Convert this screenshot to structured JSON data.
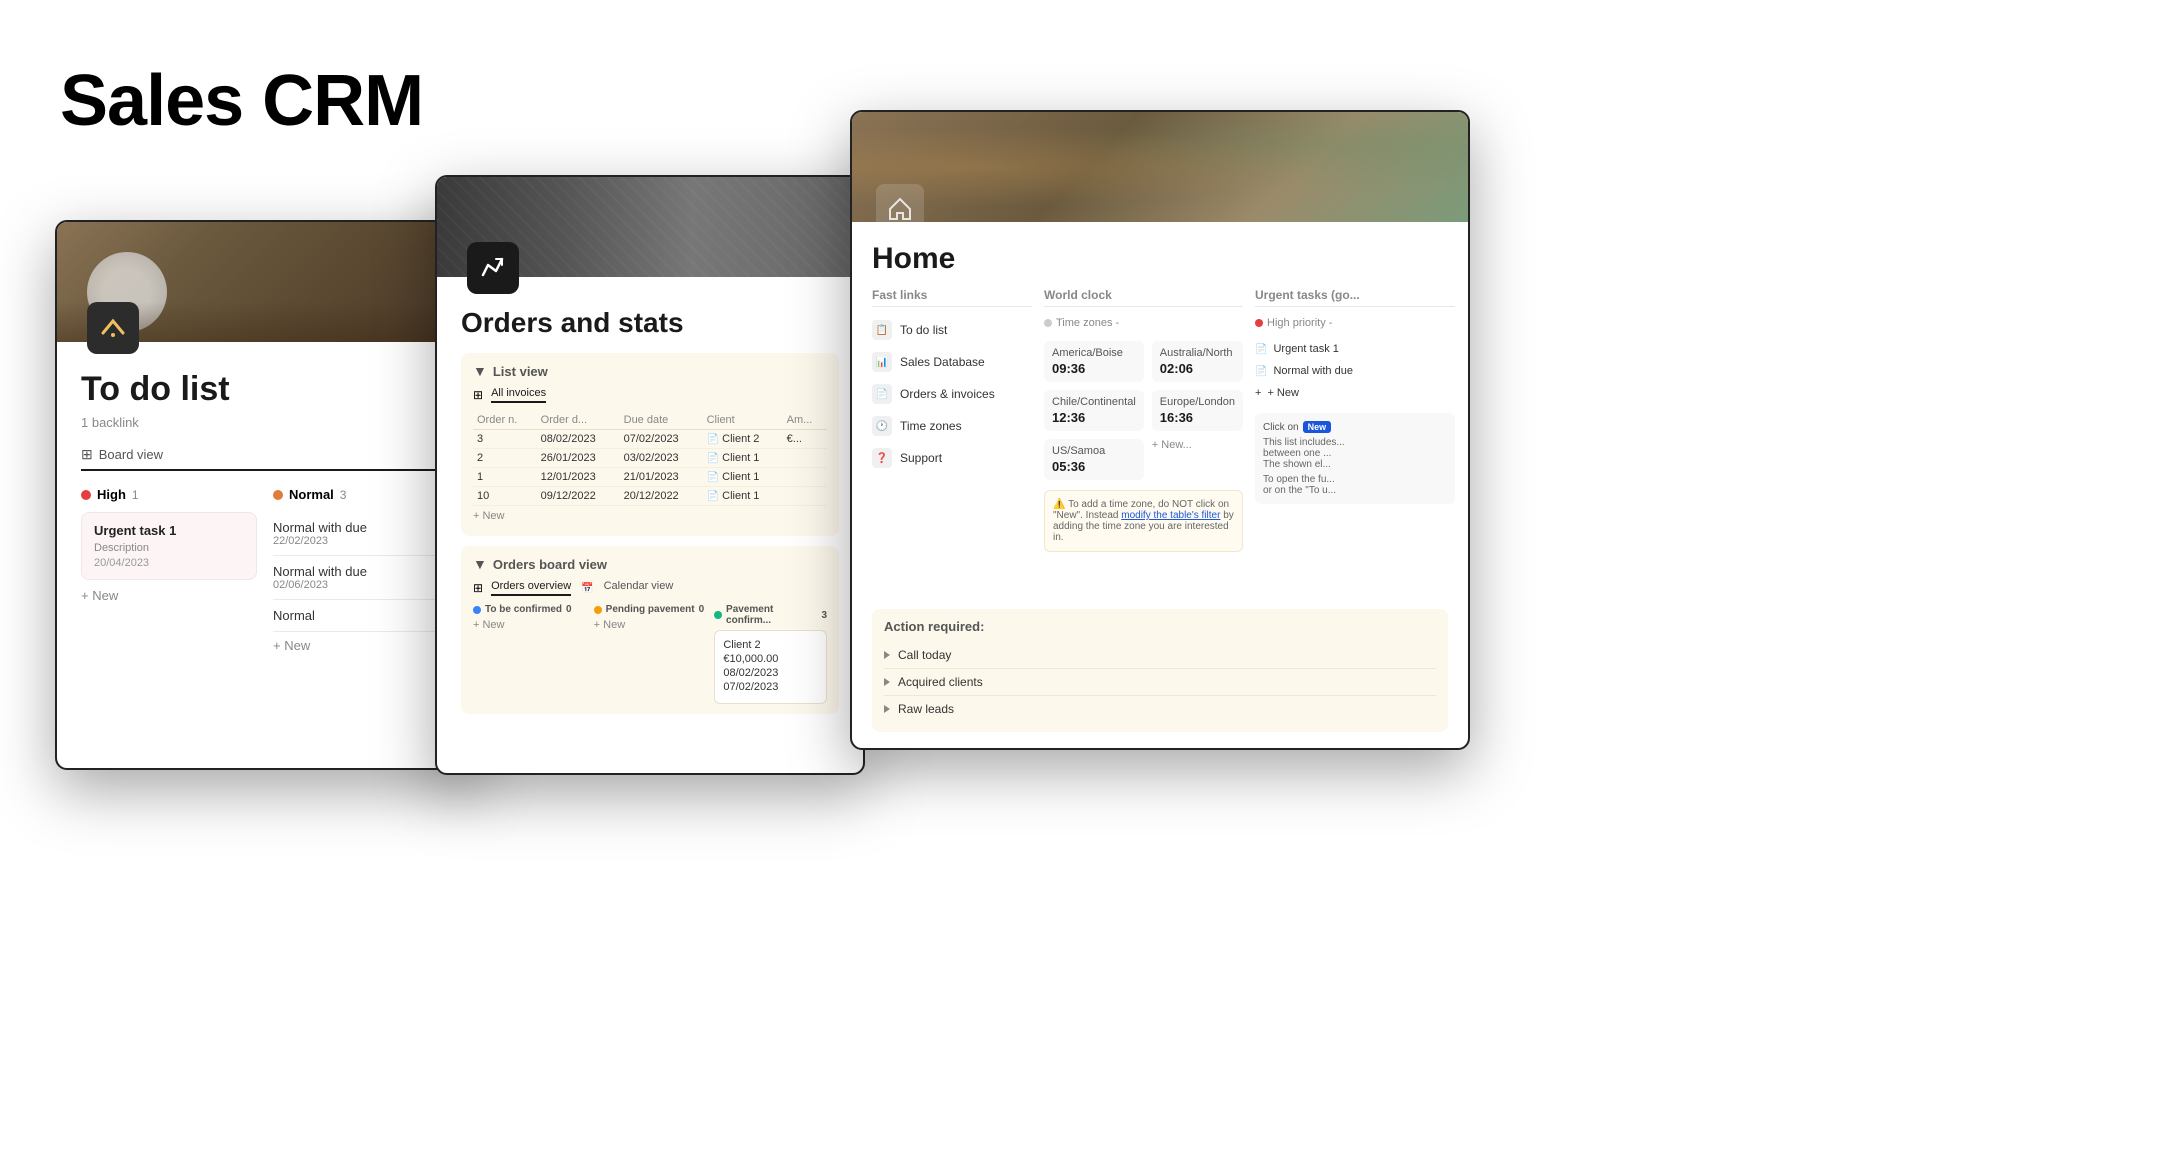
{
  "page": {
    "title": "Sales CRM"
  },
  "window1": {
    "title": "To do list",
    "backlink": "1 backlink",
    "view_label": "Board view",
    "columns": [
      {
        "id": "high",
        "label": "High",
        "count": "1",
        "color": "#e53e3e",
        "tasks": [
          {
            "name": "Urgent task 1",
            "desc": "Description",
            "date": "20/04/2023"
          }
        ],
        "add_label": "+ New"
      },
      {
        "id": "normal",
        "label": "Normal",
        "count": "3",
        "color": "#e07b39",
        "tasks": [
          {
            "name": "Normal with due",
            "date": "22/02/2023"
          },
          {
            "name": "Normal with due",
            "date": "02/06/2023"
          },
          {
            "name": "Normal",
            "date": ""
          }
        ],
        "add_label": "+ New"
      }
    ]
  },
  "window2": {
    "title": "Orders and stats",
    "list_view": {
      "label": "List view",
      "tabs": [
        "All invoices"
      ],
      "table_headers": [
        "Order n.",
        "Order d...",
        "Due date",
        "Client",
        "Am..."
      ],
      "rows": [
        {
          "order": "3",
          "order_date": "08/02/2023",
          "due_date": "07/02/2023",
          "client": "Client 2",
          "amount": "€..."
        },
        {
          "order": "2",
          "order_date": "26/01/2023",
          "due_date": "03/02/2023",
          "client": "Client 1",
          "amount": ""
        },
        {
          "order": "1",
          "order_date": "12/01/2023",
          "due_date": "21/01/2023",
          "client": "Client 1",
          "amount": ""
        },
        {
          "order": "10",
          "order_date": "09/12/2022",
          "due_date": "20/12/2022",
          "client": "Client 1",
          "amount": ""
        }
      ],
      "add_row": "+ New"
    },
    "orders_board": {
      "label": "Orders board view",
      "tabs": [
        "Orders overview",
        "Calendar view"
      ],
      "columns": [
        {
          "label": "To be confirmed",
          "count": "0",
          "color": "#3b82f6",
          "add": "+ New"
        },
        {
          "label": "Pending pavement",
          "count": "0",
          "color": "#f59e0b",
          "add": "+ New"
        },
        {
          "label": "Pavement confirm...",
          "count": "3",
          "color": "#10b981",
          "card": {
            "lines": [
              "Client 2",
              "€10,000.00",
              "08/02/2023",
              "07/02/2023"
            ]
          }
        }
      ]
    }
  },
  "window3": {
    "title": "Home",
    "fast_links": {
      "label": "Fast links",
      "items": [
        {
          "icon": "📋",
          "label": "To do list"
        },
        {
          "icon": "📊",
          "label": "Sales Database"
        },
        {
          "icon": "📄",
          "label": "Orders & invoices"
        },
        {
          "icon": "🕐",
          "label": "Time zones"
        },
        {
          "icon": "❓",
          "label": "Support"
        }
      ]
    },
    "world_clock": {
      "label": "World clock",
      "timezone_label": "Time zones -",
      "clocks": [
        {
          "city": "America/Boise",
          "time": "09:36"
        },
        {
          "city": "Australia/North",
          "time": "02:06"
        },
        {
          "city": "Chile/Continental",
          "time": "12:36"
        },
        {
          "city": "Europe/London",
          "time": "16:36"
        },
        {
          "city": "US/Samoa",
          "time": "05:36"
        }
      ],
      "add_tz": "+ New...",
      "note": "To add a time zone, do NOT click on \"New\". Instead modify the table's filter by adding the time zone you are interested in."
    },
    "urgent_tasks": {
      "label": "Urgent tasks (go...",
      "priority_label": "High priority -",
      "items": [
        {
          "label": "Urgent task 1"
        },
        {
          "label": "Normal with due"
        }
      ],
      "add": "+ New",
      "new_badge": "New",
      "click_info": "Click on\nThis list includes...\nbetween one...\nThe shown el...\n\nTo open the fu...\nor on the \"To u..."
    },
    "action_required": {
      "label": "Action required:",
      "items": [
        {
          "label": "Call today"
        },
        {
          "label": "Acquired clients"
        },
        {
          "label": "Raw leads"
        }
      ]
    }
  }
}
